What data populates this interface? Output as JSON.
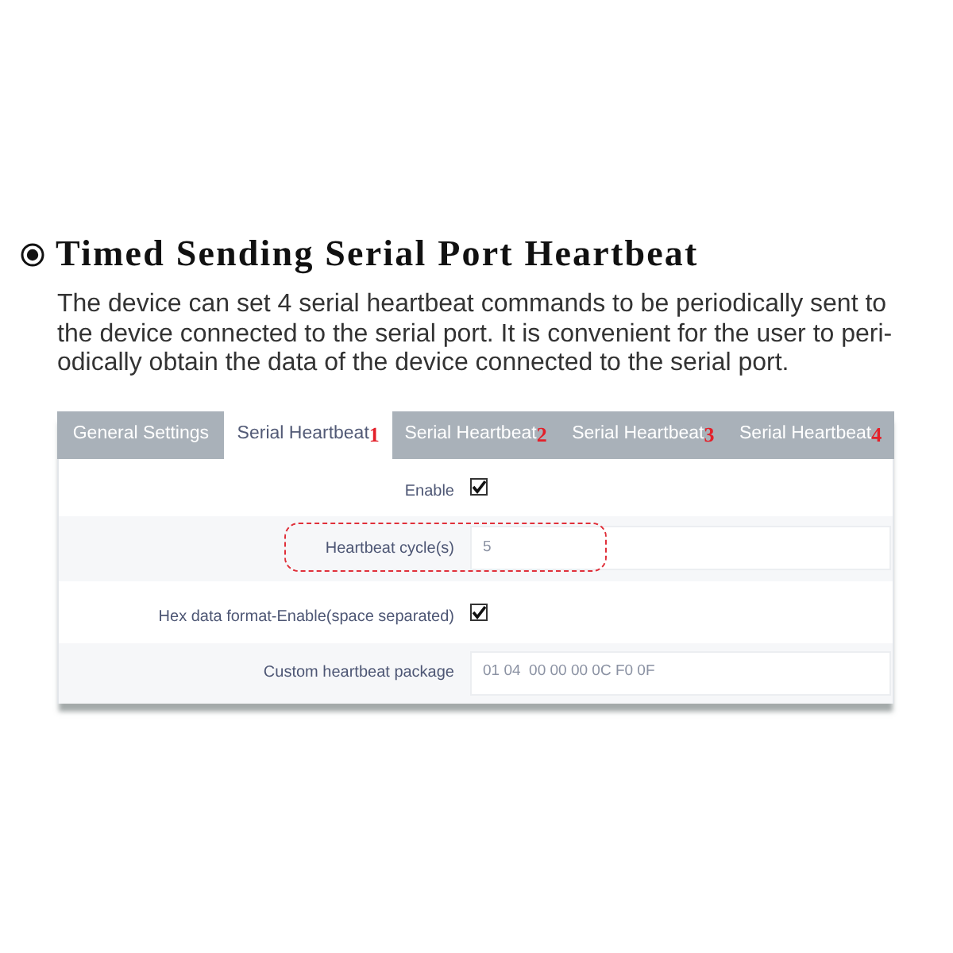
{
  "section": {
    "title": "Timed Sending Serial Port Heartbeat",
    "description_lines": [
      "The device can set 4 serial heartbeat commands to be periodically sent to",
      "the device connected to the serial port. It is convenient for the user to peri-",
      "odically obtain the data of the device connected to the serial port."
    ]
  },
  "tabs": [
    {
      "label": "General Settings",
      "selected": false
    },
    {
      "label": "Serial Heartbeat",
      "number": "1",
      "selected": true
    },
    {
      "label": "Serial Heartbeat",
      "number": "2",
      "selected": false
    },
    {
      "label": "Serial Heartbeat",
      "number": "3",
      "selected": false
    },
    {
      "label": "Serial Heartbeat",
      "number": "4",
      "selected": false
    }
  ],
  "form_rows": [
    {
      "kind": "checkbox",
      "label": "Enable",
      "checked": true,
      "highlighted": false
    },
    {
      "kind": "text",
      "label": "Heartbeat cycle(s)",
      "value": "5",
      "highlighted": true
    },
    {
      "kind": "checkbox",
      "label": "Hex data format-Enable(space separated)",
      "checked": true,
      "highlighted": false
    },
    {
      "kind": "text",
      "label": "Custom heartbeat package",
      "value": "01 04  00 00 00 0C F0 0F",
      "highlighted": false
    }
  ]
}
